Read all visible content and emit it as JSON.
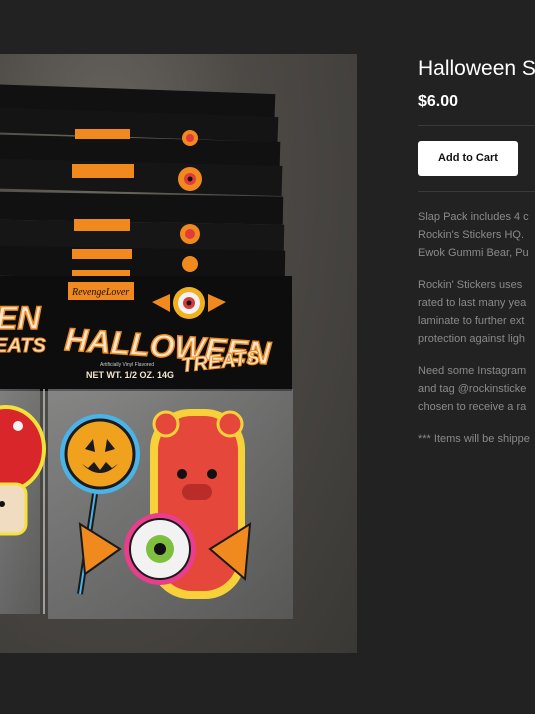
{
  "product": {
    "title": "Halloween S",
    "price": "$6.00",
    "add_to_cart_label": "Add to Cart"
  },
  "description": {
    "paragraphs": [
      [
        "Slap Pack includes 4 c",
        "Rockin's Stickers HQ.",
        "Ewok Gummi Bear, Pu"
      ],
      [
        "Rockin' Stickers uses",
        "rated to last many yea",
        "laminate to further ext",
        "protection against ligh"
      ],
      [
        "Need some Instagram",
        "and tag @rockinsticke",
        "chosen to receive a ra"
      ],
      [
        "*** Items will be shippe"
      ]
    ]
  },
  "image": {
    "header_brand": "RevengeLover",
    "pack_title_1": "HALLOWEEN",
    "pack_title_2": "TREATS",
    "pack_small_text": "Artificially Vinyl Flavored",
    "pack_weight": "NET WT. 1/2 OZ. 14G",
    "left_pack_partial_1": "EN",
    "left_pack_partial_2": "EATS"
  },
  "colors": {
    "background": "#222222",
    "accent_orange": "#f08a1e",
    "button_bg": "#ffffff",
    "muted_text": "#8a8a8a"
  }
}
